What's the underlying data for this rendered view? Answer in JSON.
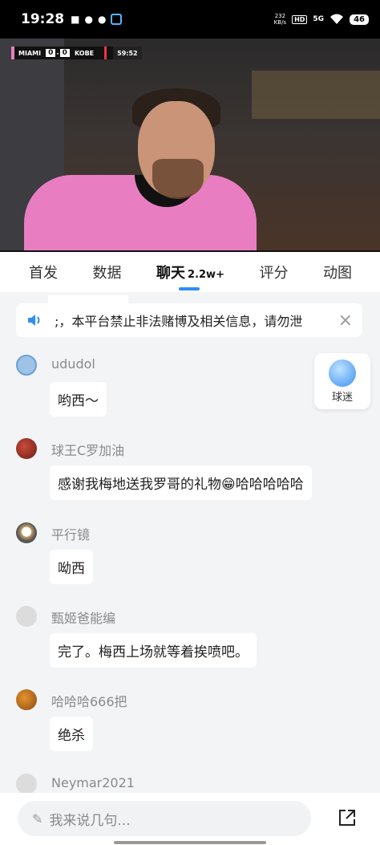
{
  "status_bar": {
    "time": "19:28",
    "net_speed_value": "232",
    "net_speed_unit": "KB/s",
    "hd": "HD",
    "signal": "5G",
    "battery": "46"
  },
  "video": {
    "team_home": "MIAMI",
    "score_home": "0",
    "score_away": "0",
    "team_away": "KOBE",
    "clock": "59:52"
  },
  "tabs": [
    {
      "label": "首发"
    },
    {
      "label": "数据"
    },
    {
      "label": "聊天",
      "count": "2.2w+"
    },
    {
      "label": "评分"
    },
    {
      "label": "动图"
    }
  ],
  "notice": {
    "text": ";，本平台禁止非法赌博及相关信息，请勿泄"
  },
  "fan_widget": {
    "label": "球迷"
  },
  "messages": [
    {
      "user": "ududol",
      "text": "哟西～"
    },
    {
      "user": "球王C罗加油",
      "text": "感谢我梅地送我罗哥的礼物😁哈哈哈哈哈"
    },
    {
      "user": "平行镜",
      "text": "呦西"
    },
    {
      "user": "甄姬爸能编",
      "text": "完了。梅西上场就等着挨喷吧。"
    },
    {
      "user": "哈哈哈666把",
      "text": "绝杀"
    },
    {
      "user": "Neymar2021",
      "text": ""
    }
  ],
  "input": {
    "placeholder": "我来说几句..."
  },
  "colors": {
    "accent": "#2f8ef4",
    "jersey": "#e87ec1"
  }
}
